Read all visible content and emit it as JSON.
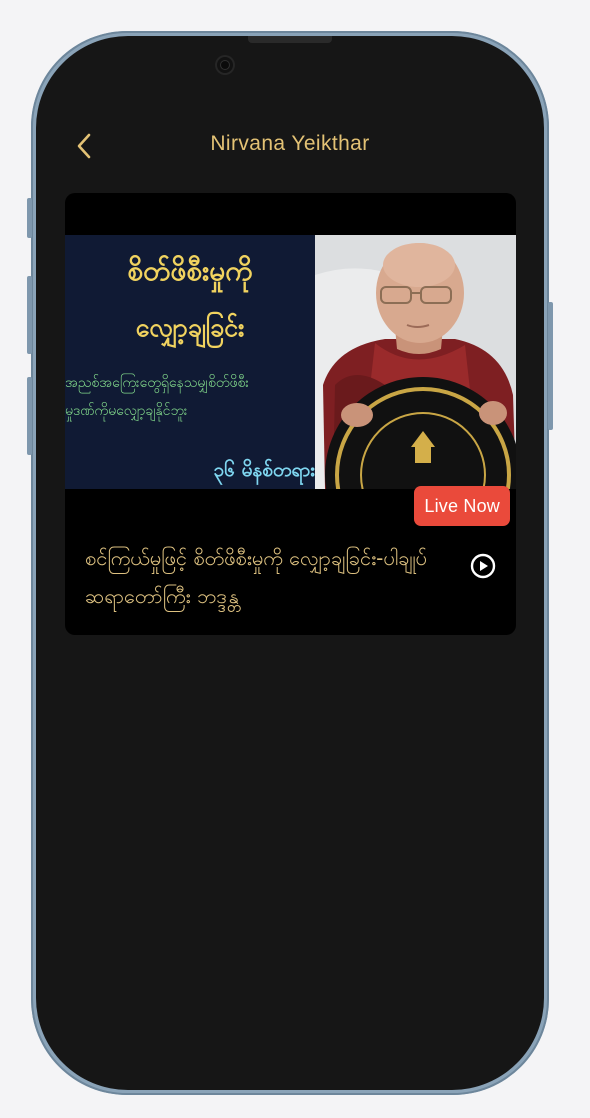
{
  "header": {
    "title": "Nirvana Yeikthar",
    "back_icon": "chevron-left-icon"
  },
  "video_card": {
    "thumbnail": {
      "title_line1": "စိတ်ဖိစီးမှုကို",
      "title_line2": "လျှော့ချခြင်း",
      "subtitle": "အညစ်အကြေးတွေရှိနေသမျှစိတ်ဖိစီး\nမှုဒဏ်ကိုမလျှော့ချနိုင်ဘူး",
      "duration": "၃၆ မိနစ်တရား"
    },
    "badge": "Live Now",
    "title": "စင်ကြယ်မှုဖြင့် စိတ်ဖိစီးမှုကို လျှော့ချခြင်း-ပါချုပ်ဆရာတော်ကြီး ဘဒ္ဒန္တ",
    "play_icon": "play-circle-icon"
  },
  "colors": {
    "accent_gold": "#e3c275",
    "badge_red": "#ea4a3b",
    "background": "#161616",
    "card": "#000000"
  }
}
